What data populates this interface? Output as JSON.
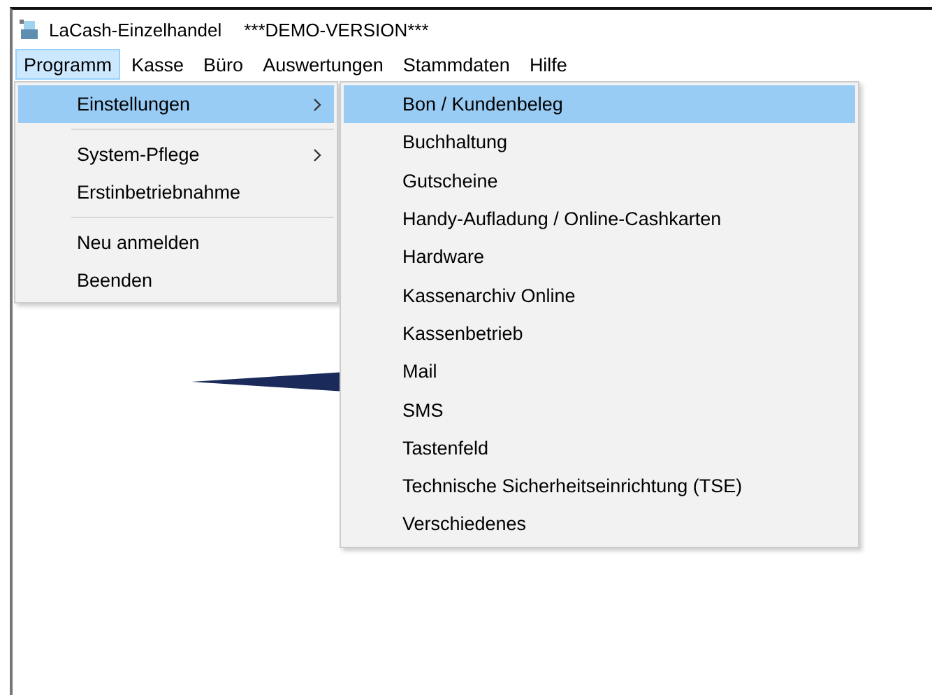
{
  "window": {
    "title": "LaCash-Einzelhandel",
    "subtitle": "***DEMO-VERSION***"
  },
  "menu_bar": [
    {
      "label": "Programm",
      "selected": true
    },
    {
      "label": "Kasse",
      "selected": false
    },
    {
      "label": "Büro",
      "selected": false
    },
    {
      "label": "Auswertungen",
      "selected": false
    },
    {
      "label": "Stammdaten",
      "selected": false
    },
    {
      "label": "Hilfe",
      "selected": false
    }
  ],
  "menu": [
    {
      "kind": "item",
      "label": "Einstellungen",
      "submenu": true,
      "selected": true
    },
    {
      "kind": "separator"
    },
    {
      "kind": "item",
      "label": "System-Pflege",
      "submenu": true,
      "selected": false
    },
    {
      "kind": "item",
      "label": "Erstinbetriebnahme",
      "submenu": false,
      "selected": false
    },
    {
      "kind": "separator"
    },
    {
      "kind": "item",
      "label": "Neu anmelden",
      "submenu": false,
      "selected": false
    },
    {
      "kind": "item",
      "label": "Beenden",
      "submenu": false,
      "selected": false
    }
  ],
  "submenu": [
    {
      "label": "Bon / Kundenbeleg",
      "selected": true
    },
    {
      "label": "Buchhaltung",
      "selected": false
    },
    {
      "label": "Gutscheine",
      "selected": false
    },
    {
      "label": "Handy-Aufladung / Online-Cashkarten",
      "selected": false
    },
    {
      "label": "Hardware",
      "selected": false
    },
    {
      "label": "Kassenarchiv Online",
      "selected": false
    },
    {
      "label": "Kassenbetrieb",
      "selected": false
    },
    {
      "label": "Mail",
      "selected": false
    },
    {
      "label": "SMS",
      "selected": false
    },
    {
      "label": "Tastenfeld",
      "selected": false
    },
    {
      "label": "Technische Sicherheitseinrichtung (TSE)",
      "selected": false
    },
    {
      "label": "Verschiedenes",
      "selected": false
    }
  ]
}
